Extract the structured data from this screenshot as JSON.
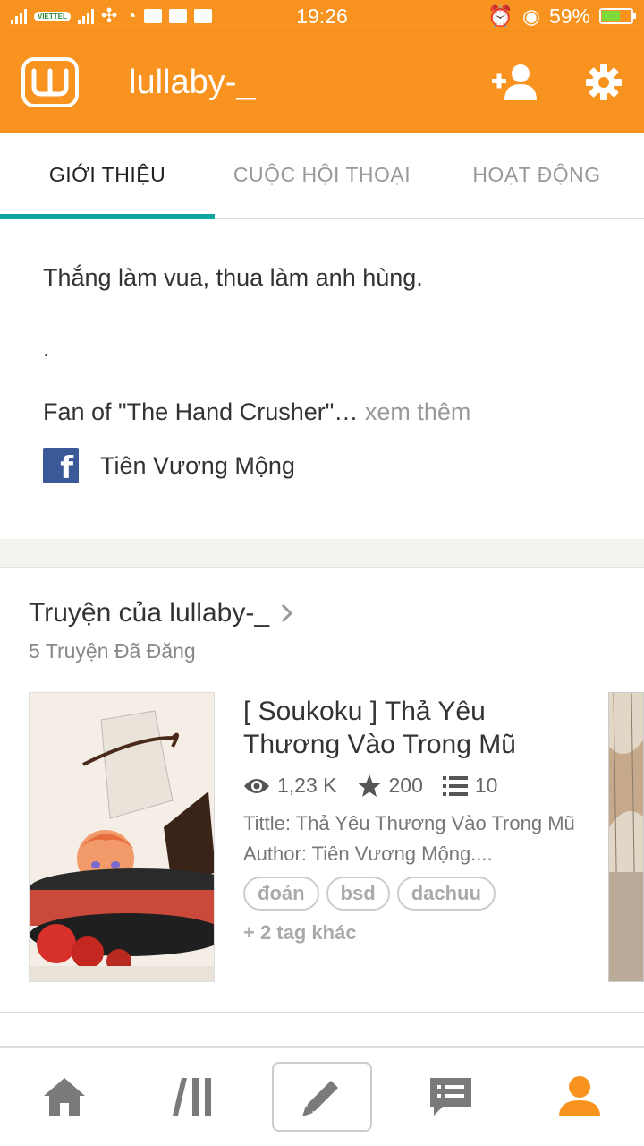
{
  "status_bar": {
    "time": "19:26",
    "carrier": "VIETTEL",
    "battery": "59%",
    "battery_level": 0.59
  },
  "app_bar": {
    "logo": "W",
    "title": "lullaby-_"
  },
  "tabs": [
    {
      "label": "GIỚI THIỆU",
      "active": true
    },
    {
      "label": "CUỘC HỘI THOẠI",
      "active": false
    },
    {
      "label": "HOẠT ĐỘNG",
      "active": false
    }
  ],
  "about": {
    "line1": "Thắng làm vua, thua làm anh hùng.",
    "line2": ".",
    "line3": "Fan of \"The Hand Crusher\"…",
    "see_more": "xem thêm",
    "facebook_name": "Tiên Vương Mộng"
  },
  "stories": {
    "title": "Truyện của lullaby-_",
    "subtitle": "5 Truyện Đã Đăng",
    "items": [
      {
        "title": "[ Soukoku ] Thả Yêu Thương Vào Trong Mũ",
        "views": "1,23 K",
        "votes": "200",
        "parts": "10",
        "desc_line1": "Tittle: Thả Yêu Thương Vào Trong Mũ",
        "desc_line2": "Author: Tiên Vương Mộng....",
        "tags": [
          "đoản",
          "bsd",
          "dachuu"
        ],
        "more_tags": "+ 2 tag khác"
      }
    ]
  },
  "colors": {
    "brand_orange": "#f7931e",
    "tab_accent": "#0fa5a0",
    "facebook": "#3b5998"
  },
  "bottom_nav": [
    "home-icon",
    "library-icon",
    "write-icon",
    "messages-icon",
    "profile-icon"
  ]
}
